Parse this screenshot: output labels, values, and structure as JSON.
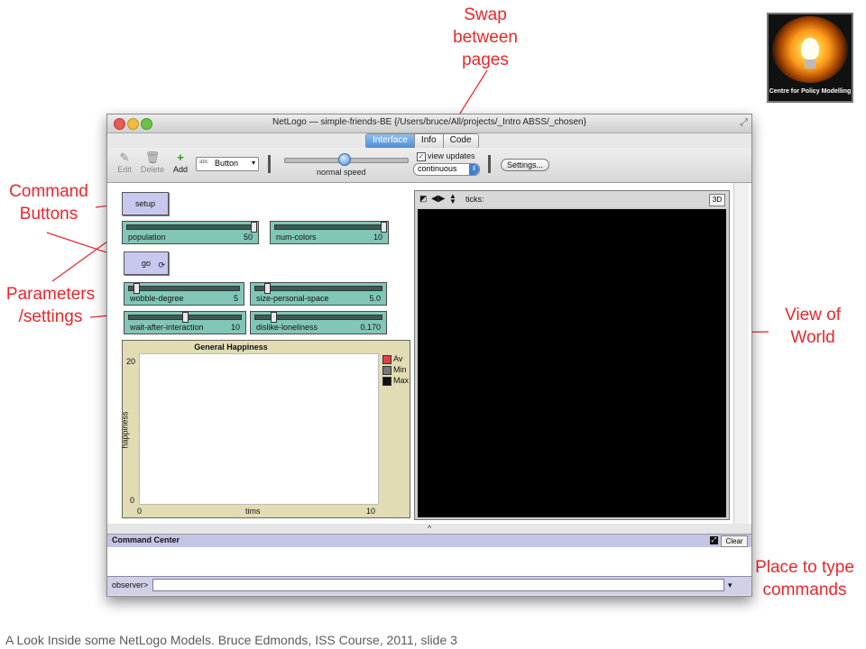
{
  "annotations": {
    "swap_pages": "Swap\nbetween\npages",
    "swap_line1": "Swap",
    "swap_line2": "between",
    "swap_line3": "pages",
    "command_buttons_1": "Command",
    "command_buttons_2": "Buttons",
    "parameters_1": "Parameters",
    "parameters_2": "/settings",
    "view_1": "View of",
    "view_2": "World",
    "place_1": "Place to type",
    "place_2": "commands",
    "color": "#e8282b"
  },
  "logo": {
    "text": "Centre for Policy Modelling"
  },
  "window": {
    "title": "NetLogo — simple-friends-BE {/Users/bruce/All/projects/_Intro ABSS/_chosen}",
    "tabs": [
      {
        "label": "Interface",
        "active": true
      },
      {
        "label": "Info",
        "active": false
      },
      {
        "label": "Code",
        "active": false
      }
    ]
  },
  "toolbar": {
    "edit_label": "Edit",
    "delete_label": "Delete",
    "add_label": "Add",
    "widget_type": "Button",
    "widget_prefix": "abc",
    "speed_label": "normal speed",
    "view_updates_label": "view updates",
    "view_updates_checked": "✓",
    "update_mode": "continuous",
    "settings_label": "Settings..."
  },
  "buttons": {
    "setup": "setup",
    "go": "go"
  },
  "sliders": [
    {
      "name": "population",
      "value": "50"
    },
    {
      "name": "num-colors",
      "value": "10"
    },
    {
      "name": "wobble-degree",
      "value": "5"
    },
    {
      "name": "size-personal-space",
      "value": "5.0"
    },
    {
      "name": "wait-after-interaction",
      "value": "10"
    },
    {
      "name": "dislike-loneliness",
      "value": "0.170"
    }
  ],
  "plot": {
    "title": "General Happiness",
    "ylabel": "happiness",
    "xlabel": "tims",
    "ymax": "20",
    "ymin": "0",
    "xmin": "0",
    "xmax": "10",
    "legend": [
      {
        "label": "Av",
        "color": "#e04040"
      },
      {
        "label": "Min",
        "color": "#777777"
      },
      {
        "label": "Max",
        "color": "#111111"
      }
    ]
  },
  "view": {
    "ticks_label": "ticks:",
    "three_d_label": "3D"
  },
  "command_center": {
    "title": "Command Center",
    "clear_label": "Clear",
    "prompt": "observer>",
    "input_value": ""
  },
  "footer": "A Look Inside some NetLogo Models. Bruce Edmonds,  ISS Course, 2011, slide 3"
}
